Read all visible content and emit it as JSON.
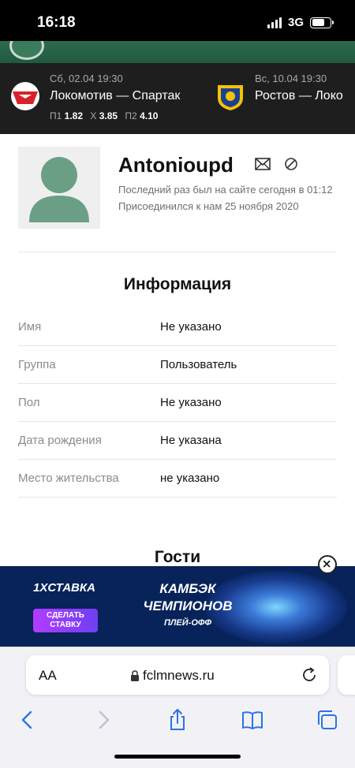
{
  "status_bar": {
    "time": "16:18",
    "network": "3G"
  },
  "matches": [
    {
      "date": "Сб, 02.04 19:30",
      "teams": "Локомотив — Спартак",
      "odds": [
        {
          "label": "П1",
          "value": "1.82"
        },
        {
          "label": "Х",
          "value": "3.85"
        },
        {
          "label": "П2",
          "value": "4.10"
        }
      ],
      "logo": "spartak-logo-icon"
    },
    {
      "date": "Вс, 10.04 19:30",
      "teams": "Ростов — Локо",
      "logo": "rostov-logo-icon"
    }
  ],
  "profile": {
    "name": "Antonioupd",
    "last_seen": "Последний раз был на сайте сегодня в 01:12",
    "joined": "Присоединился к нам 25 ноября 2020"
  },
  "info": {
    "title": "Информация",
    "rows": [
      {
        "label": "Имя",
        "value": "Не указано"
      },
      {
        "label": "Группа",
        "value": "Пользователь"
      },
      {
        "label": "Пол",
        "value": "Не указано"
      },
      {
        "label": "Дата рождения",
        "value": "Не указана"
      },
      {
        "label": "Место жительства",
        "value": "не указано"
      }
    ]
  },
  "guests": {
    "title": "Гости"
  },
  "ad": {
    "brand": "1XСТАВКА",
    "cta": "СДЕЛАТЬ СТАВКУ",
    "title": "КАМБЭК ЧЕМПИОНОВ",
    "subtitle": "ПЛЕЙ-ОФФ",
    "colors": {
      "background": "#07235a",
      "cta": "#9b3cf7"
    }
  },
  "browser": {
    "aa": "AA",
    "url": "fclmnews.ru"
  },
  "colors": {
    "site_green": "#2d6b4e",
    "match_bar": "#1e1e1e",
    "avatar": "#6a9f86"
  }
}
